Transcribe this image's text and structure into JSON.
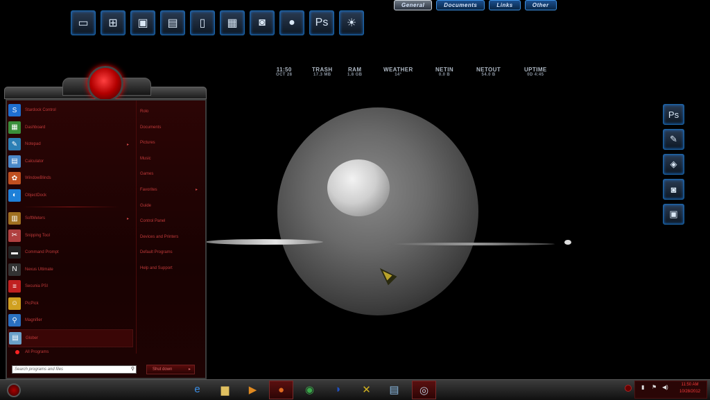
{
  "top_dock": [
    {
      "icon": "monitor-icon",
      "glyph": "▭"
    },
    {
      "icon": "network-icon",
      "glyph": "⊞"
    },
    {
      "icon": "control-panel-icon",
      "glyph": "▣"
    },
    {
      "icon": "disk-icon",
      "glyph": "▤"
    },
    {
      "icon": "documents-icon",
      "glyph": "▯"
    },
    {
      "icon": "drive-icon",
      "glyph": "▦"
    },
    {
      "icon": "camera-icon",
      "glyph": "◙"
    },
    {
      "icon": "firefox-icon",
      "glyph": "●"
    },
    {
      "icon": "photoshop-icon",
      "glyph": "Ps"
    },
    {
      "icon": "weather-sun-icon",
      "glyph": "☀"
    }
  ],
  "top_tabs": [
    "General",
    "Documents",
    "Links",
    "Other"
  ],
  "stats": [
    {
      "label": "11:50",
      "value": "OCT 28"
    },
    {
      "label": "TRASH",
      "value": "17.3 MB"
    },
    {
      "label": "RAM",
      "value": "1.8 GB"
    },
    {
      "label": "WEATHER",
      "value": "14°"
    },
    {
      "label": "NETIN",
      "value": "0.0 B"
    },
    {
      "label": "NETOUT",
      "value": "54.0 B"
    },
    {
      "label": "UPTIME",
      "value": "0D 4:45"
    }
  ],
  "right_dock": [
    {
      "icon": "photoshop-icon",
      "glyph": "Ps"
    },
    {
      "icon": "paint-icon",
      "glyph": "✎"
    },
    {
      "icon": "cube-icon",
      "glyph": "◈"
    },
    {
      "icon": "camera-icon",
      "glyph": "◙"
    },
    {
      "icon": "screenshot-icon",
      "glyph": "▣"
    }
  ],
  "start_menu": {
    "left_items": [
      {
        "label": "Stardock Control",
        "icon": "stardock-icon",
        "glyph": "S",
        "color": "#1f6fd0"
      },
      {
        "label": "Dashboard",
        "icon": "dashboard-icon",
        "glyph": "▦",
        "color": "#3a8e3a"
      },
      {
        "label": "Notepad",
        "icon": "notepad-icon",
        "glyph": "✎",
        "color": "#2c7fb5",
        "arrow": true
      },
      {
        "label": "Calculator",
        "icon": "calculator-icon",
        "glyph": "▤",
        "color": "#4a88c8"
      },
      {
        "label": "WindowBlinds",
        "icon": "windowblinds-icon",
        "glyph": "✿",
        "color": "#c05020"
      },
      {
        "label": "ObjectDock",
        "icon": "objectdock-icon",
        "glyph": "◐",
        "color": "#1e80d8"
      },
      {
        "sep": true
      },
      {
        "label": "SoftMeters",
        "icon": "softmeters-icon",
        "glyph": "▥",
        "color": "#a07020",
        "arrow": true
      },
      {
        "label": "Snipping Tool",
        "icon": "snipping-tool-icon",
        "glyph": "✂",
        "color": "#b04040"
      },
      {
        "label": "Command Prompt",
        "icon": "command-prompt-icon",
        "glyph": "▬",
        "color": "#222"
      },
      {
        "label": "Nexus Ultimate",
        "icon": "nexus-icon",
        "glyph": "N",
        "color": "#333"
      },
      {
        "label": "Secunia PSI",
        "icon": "secunia-icon",
        "glyph": "≡",
        "color": "#c02020"
      },
      {
        "label": "PicPick",
        "icon": "picpick-icon",
        "glyph": "☺",
        "color": "#d0a020"
      },
      {
        "label": "Magnifier",
        "icon": "magnifier-icon",
        "glyph": "⚲",
        "color": "#2a70c0"
      },
      {
        "label": "Glober",
        "icon": "glober-icon",
        "glyph": "▤",
        "color": "#6aa0c8",
        "selected": true
      }
    ],
    "all_programs": "All Programs",
    "right_items": [
      {
        "label": "Rolo"
      },
      {
        "label": "Documents"
      },
      {
        "label": "Pictures"
      },
      {
        "label": "Music"
      },
      {
        "label": "Games"
      },
      {
        "label": "Favorites",
        "arrow": true
      },
      {
        "label": "Guide"
      },
      {
        "label": "Control Panel"
      },
      {
        "label": "Devices and Printers"
      },
      {
        "label": "Default Programs"
      },
      {
        "label": "Help and Support"
      }
    ],
    "search_placeholder": "Search programs and files",
    "shutdown_label": "Shut down"
  },
  "taskbar": [
    {
      "icon": "internet-explorer-icon",
      "glyph": "e",
      "color": "#3a8ee6"
    },
    {
      "icon": "file-explorer-icon",
      "glyph": "▆",
      "color": "#e0c060"
    },
    {
      "icon": "media-player-icon",
      "glyph": "▶",
      "color": "#e08a20"
    },
    {
      "icon": "firefox-icon",
      "glyph": "●",
      "color": "#e06a20",
      "active": true
    },
    {
      "icon": "chrome-icon",
      "glyph": "◉",
      "color": "#3aa84a"
    },
    {
      "icon": "moon-app-icon",
      "glyph": "◑",
      "color": "#2050c0"
    },
    {
      "icon": "x-tool-icon",
      "glyph": "✕",
      "color": "#d0b020"
    },
    {
      "icon": "glober-icon",
      "glyph": "▤",
      "color": "#8ab8e0"
    },
    {
      "icon": "steam-icon",
      "glyph": "◎",
      "color": "#bcd",
      "active": true
    }
  ],
  "tray": {
    "time": "11:50 AM",
    "date": "10/28/2012"
  }
}
